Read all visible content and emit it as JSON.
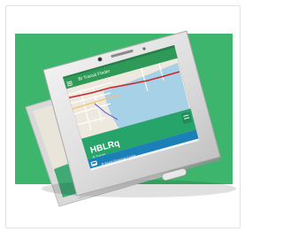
{
  "app": {
    "toolbar_title": "BI Transit Finder",
    "route_code": "HBLRq",
    "route_subtitle": "Ø Transit",
    "stop_label": "Ø World Financial Center"
  },
  "colors": {
    "background_green": "#3db56c",
    "app_bar": "#2f9a57",
    "route_card": "#27a46a",
    "stop_bar": "#1b7fb8",
    "map_water": "#a7d1e6",
    "map_land": "#eee9df",
    "route_line": "#c62828"
  },
  "icons": {
    "camera": "front-camera-icon",
    "speaker": "earpiece-icon",
    "home_button": "home-button",
    "bus": "bus-icon",
    "back": "back-nav-icon",
    "home": "home-nav-icon",
    "recents": "recents-nav-icon",
    "locate": "locate-fab-icon"
  }
}
